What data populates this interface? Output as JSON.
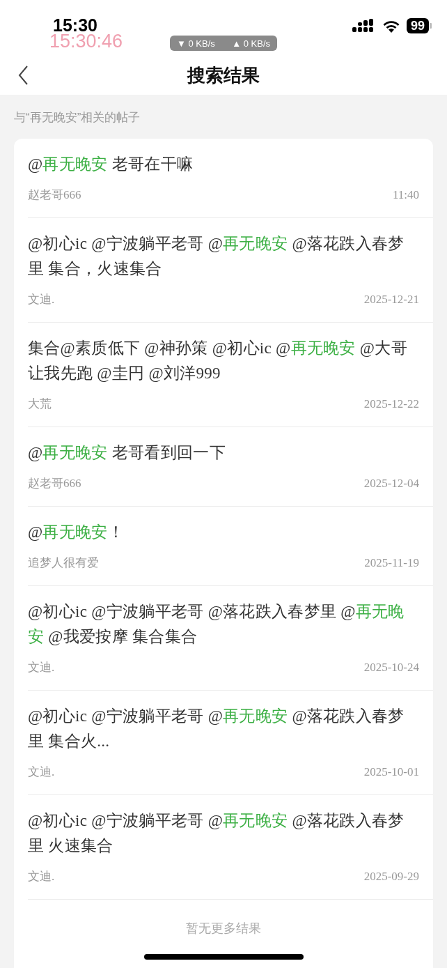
{
  "status_bar": {
    "time": "15:30",
    "overlay_time": "15:30:46",
    "download_speed": "▼ 0 KB/s",
    "upload_speed": "▲ 0 KB/s",
    "battery": "99"
  },
  "nav": {
    "title": "搜索结果"
  },
  "subtitle": "与“再无晚安”相关的帖子",
  "posts": [
    {
      "segments": [
        {
          "text": "@",
          "highlight": false
        },
        {
          "text": "再无晚安",
          "highlight": true
        },
        {
          "text": " 老哥在干嘛",
          "highlight": false
        }
      ],
      "author": "赵老哥666",
      "time": "11:40"
    },
    {
      "segments": [
        {
          "text": "@初心ic @宁波躺平老哥 @",
          "highlight": false
        },
        {
          "text": "再无晚安",
          "highlight": true
        },
        {
          "text": " @落花跌入春梦里 集合，火速集合",
          "highlight": false
        }
      ],
      "author": "文迪.",
      "time": "2025-12-21"
    },
    {
      "segments": [
        {
          "text": "集合@素质低下 @神孙策 @初心ic @",
          "highlight": false
        },
        {
          "text": "再无晚安",
          "highlight": true
        },
        {
          "text": " @大哥让我先跑 @圭円 @刘洋999",
          "highlight": false
        }
      ],
      "author": "大荒",
      "time": "2025-12-22"
    },
    {
      "segments": [
        {
          "text": "@",
          "highlight": false
        },
        {
          "text": "再无晚安",
          "highlight": true
        },
        {
          "text": " 老哥看到回一下",
          "highlight": false
        }
      ],
      "author": "赵老哥666",
      "time": "2025-12-04"
    },
    {
      "segments": [
        {
          "text": "@",
          "highlight": false
        },
        {
          "text": "再无晚安",
          "highlight": true
        },
        {
          "text": "！",
          "highlight": false
        }
      ],
      "author": "追梦人很有爱",
      "time": "2025-11-19"
    },
    {
      "segments": [
        {
          "text": "@初心ic @宁波躺平老哥 @落花跌入春梦里 @",
          "highlight": false
        },
        {
          "text": "再无晚安",
          "highlight": true
        },
        {
          "text": " @我爱按摩 集合集合",
          "highlight": false
        }
      ],
      "author": "文迪.",
      "time": "2025-10-24"
    },
    {
      "segments": [
        {
          "text": "@初心ic @宁波躺平老哥 @",
          "highlight": false
        },
        {
          "text": "再无晚安",
          "highlight": true
        },
        {
          "text": " @落花跌入春梦里 集合火...",
          "highlight": false
        }
      ],
      "author": "文迪.",
      "time": "2025-10-01"
    },
    {
      "segments": [
        {
          "text": "@初心ic @宁波躺平老哥 @",
          "highlight": false
        },
        {
          "text": "再无晚安",
          "highlight": true
        },
        {
          "text": " @落花跌入春梦里 火速集合",
          "highlight": false
        }
      ],
      "author": "文迪.",
      "time": "2025-09-29"
    }
  ],
  "footer": "暂无更多结果"
}
